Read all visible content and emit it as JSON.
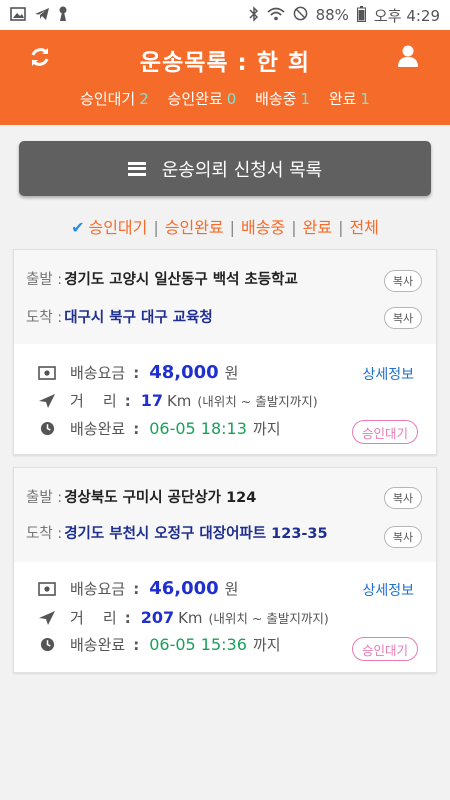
{
  "status_bar": {
    "battery": "88%",
    "ampm": "오후",
    "time": "4:29"
  },
  "header": {
    "title": "운송목록 : 한 희",
    "counts": [
      {
        "label": "승인대기",
        "value": "2"
      },
      {
        "label": "승인완료",
        "value": "0"
      },
      {
        "label": "배송중",
        "value": "1"
      },
      {
        "label": "완료",
        "value": "1"
      }
    ]
  },
  "list_button": {
    "label": "운송의뢰 신청서 목록"
  },
  "filters": {
    "items": [
      "승인대기",
      "승인완료",
      "배송중",
      "완료",
      "전체"
    ],
    "selected": "승인대기"
  },
  "orders": [
    {
      "origin_label": "출발 :",
      "origin": "경기도 고양시 일산동구 백석 초등학교",
      "dest_label": "도착 :",
      "dest": "대구시 북구 대구 교육청",
      "copy_label": "복사",
      "fee_label": "배송요금",
      "fee": "48,000",
      "fee_unit": "원",
      "dist_label": "거    리",
      "dist": "17",
      "dist_unit": "Km",
      "dist_note": "(내위치 ~ 출발지까지)",
      "done_label": "배송완료",
      "done_time": "06-05 18:13",
      "done_suffix": "까지",
      "details_link": "상세정보",
      "status": "승인대기"
    },
    {
      "origin_label": "출발 :",
      "origin": "경상북도 구미시 공단상가 124",
      "dest_label": "도착 :",
      "dest": "경기도 부천시 오정구 대장어파트 123-35",
      "copy_label": "복사",
      "fee_label": "배송요금",
      "fee": "46,000",
      "fee_unit": "원",
      "dist_label": "거    리",
      "dist": "207",
      "dist_unit": "Km",
      "dist_note": "(내위치 ~ 출발지까지)",
      "done_label": "배송완료",
      "done_time": "06-05 15:36",
      "done_suffix": "까지",
      "details_link": "상세정보",
      "status": "승인대기"
    }
  ],
  "colors": {
    "brand": "#f56b2a",
    "count": "#7fe3d0",
    "fee": "#1f2fd0",
    "time": "#1aa05a",
    "status": "#e67bb5"
  }
}
